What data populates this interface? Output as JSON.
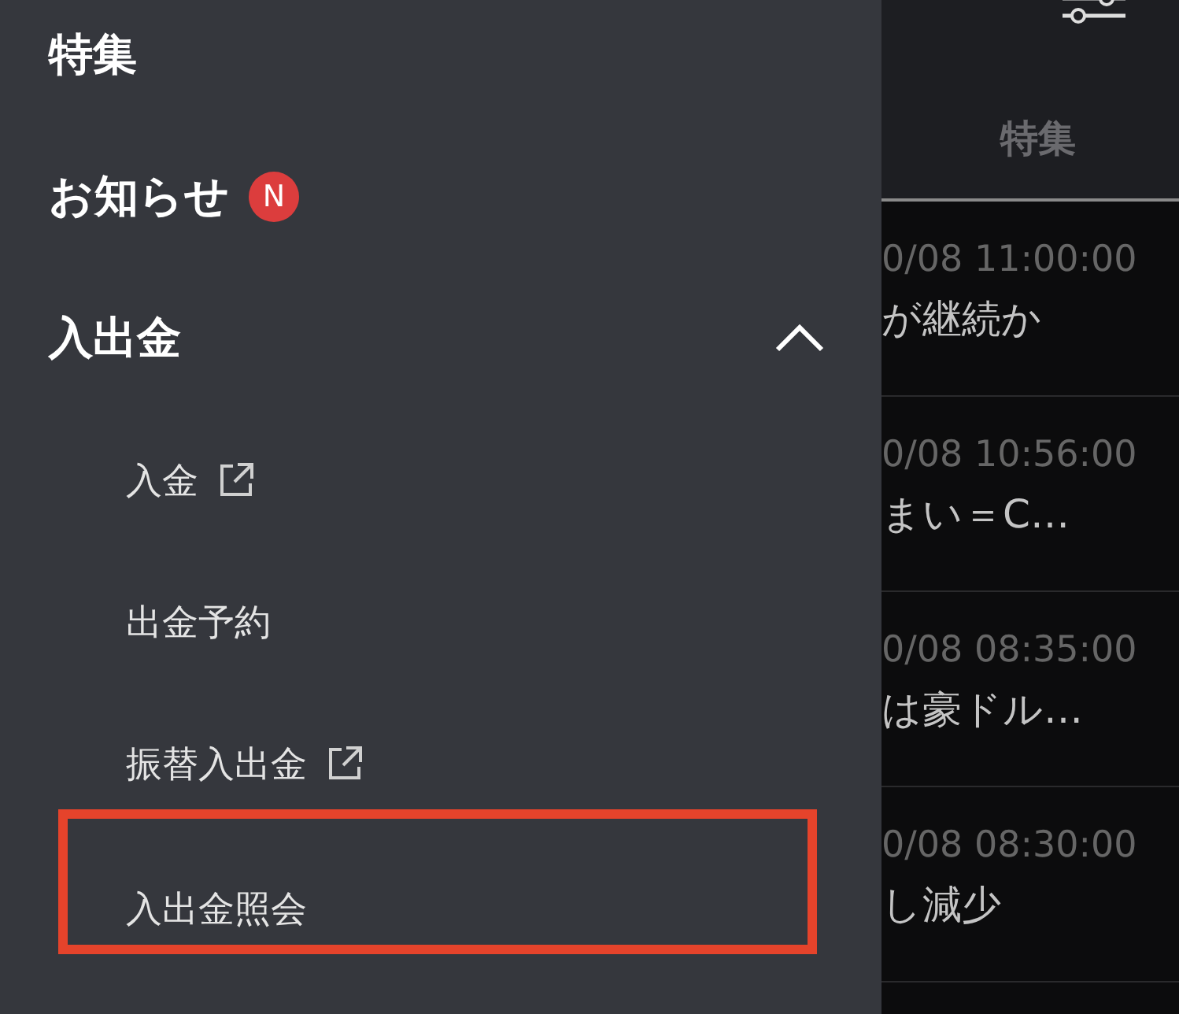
{
  "menu": {
    "items": [
      {
        "label": "特集",
        "kind": "top"
      },
      {
        "label": "お知らせ",
        "kind": "top",
        "badge": "N"
      },
      {
        "label": "入出金",
        "kind": "group",
        "expanded": true,
        "children": [
          {
            "label": "入金",
            "external": true,
            "highlighted": false
          },
          {
            "label": "出金予約",
            "external": false,
            "highlighted": false
          },
          {
            "label": "振替入出金",
            "external": true,
            "highlighted": false
          },
          {
            "label": "入出金照会",
            "external": false,
            "highlighted": true
          }
        ]
      }
    ]
  },
  "panel": {
    "tab": "特集",
    "news": [
      {
        "time": "0/08 11:00:00",
        "title": "が継続か"
      },
      {
        "time": "0/08 10:56:00",
        "title": "まい＝C…"
      },
      {
        "time": "0/08 08:35:00",
        "title": "は豪ドル…"
      },
      {
        "time": "0/08 08:30:00",
        "title": "し減少"
      }
    ]
  }
}
